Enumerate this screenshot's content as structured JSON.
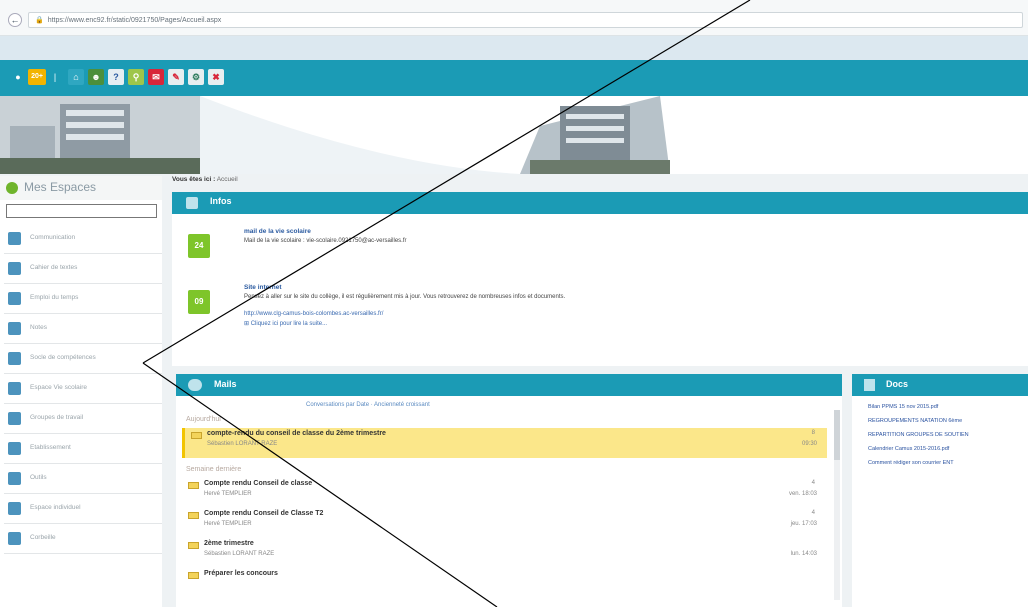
{
  "browser": {
    "url": "https://www.enc92.fr/static/0921750/Pages/Accueil.aspx"
  },
  "sidebar": {
    "title": "Mes Espaces",
    "items": [
      {
        "label": "Communication",
        "icon": "chat-icon"
      },
      {
        "label": "Cahier de textes",
        "icon": "book-icon"
      },
      {
        "label": "Emploi du temps",
        "icon": "calendar-icon"
      },
      {
        "label": "Notes",
        "icon": "grades-icon"
      },
      {
        "label": "Socle de compétences",
        "icon": "skills-icon"
      },
      {
        "label": "Espace Vie scolaire",
        "icon": "people-icon"
      },
      {
        "label": "Groupes de travail",
        "icon": "group-icon"
      },
      {
        "label": "Etablissement",
        "icon": "home-icon"
      },
      {
        "label": "Outils",
        "icon": "wrench-icon"
      },
      {
        "label": "Espace individuel",
        "icon": "folder-icon"
      },
      {
        "label": "Corbeille",
        "icon": "trash-icon"
      }
    ]
  },
  "breadcrumb": {
    "prefix": "Vous êtes ici :",
    "current": "Accueil"
  },
  "infos": {
    "title": "Infos",
    "items": [
      {
        "day": "24",
        "title": "mail de la vie scolaire",
        "text": "Mail de la vie scolaire : vie-scolaire.0921750@ac-versailles.fr"
      },
      {
        "day": "09",
        "title": "Site internet",
        "text": "Pensez à aller sur le site du collège, il est régulièrement mis à jour. Vous retrouverez de nombreuses infos et documents.",
        "link": "http://www.clg-camus-bois-colombes.ac-versailles.fr/",
        "more": "Cliquez ici pour lire la suite..."
      }
    ]
  },
  "mails": {
    "title": "Mails",
    "sort_options": "Conversations par Date  ·  Ancienneté croissant",
    "groups": [
      {
        "label": "Aujourd'hui"
      },
      {
        "label": "Semaine dernière"
      }
    ],
    "items": [
      {
        "subject": "compte-rendu du conseil de classe du 2ème trimestre",
        "from": "Sébastien LORANT RAZE",
        "date": "09:30",
        "count": "8"
      },
      {
        "subject": "Compte rendu Conseil de classe",
        "from": "Hervé TEMPLIER",
        "date": "ven. 18:03",
        "count": "4"
      },
      {
        "subject": "Compte rendu Conseil de Classe T2",
        "from": "Hervé TEMPLIER",
        "date": "jeu. 17:03",
        "count": "4"
      },
      {
        "subject": "2ème trimestre",
        "from": "Sébastien LORANT RAZE",
        "date": "lun. 14:03",
        "count": ""
      },
      {
        "subject": "Préparer les concours",
        "from": "",
        "date": "",
        "count": ""
      }
    ]
  },
  "docs": {
    "title": "Docs",
    "items": [
      "Bilan PPMS 15 nov 2015.pdf",
      "REGROUPEMENTS NATATION 6ème",
      "REPARTITION GROUPES DE SOUTIEN",
      "Calendrier Camus 2015-2016.pdf",
      "Comment rédiger son courrier ENT"
    ]
  },
  "toolbar": {
    "counter": "20+"
  },
  "colors": {
    "accent": "#1b9bb5",
    "highlight": "#fbe78a",
    "calendar": "#7ec52a"
  }
}
